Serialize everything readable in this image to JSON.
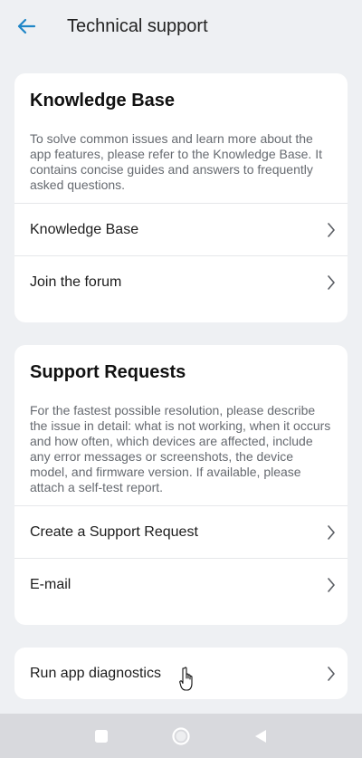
{
  "header": {
    "title": "Technical support",
    "back_icon": "arrow-left-icon",
    "accent_color": "#1f86c7"
  },
  "knowledge_card": {
    "title": "Knowledge Base",
    "description": "To solve common issues and learn more about the app features, please refer to the Knowledge Base. It contains concise guides and answers to frequently asked questions.",
    "items": [
      {
        "label": "Knowledge Base",
        "icon": "chevron-right-icon"
      },
      {
        "label": "Join the forum",
        "icon": "chevron-right-icon"
      }
    ]
  },
  "support_card": {
    "title": "Support Requests",
    "description": "For the fastest possible resolution, please describe the issue in detail: what is not working, when it occurs and how often, which devices are affected, include any error messages or screenshots, the device model, and firmware version. If available, please attach a self-test report.",
    "items": [
      {
        "label": "Create a Support Request",
        "icon": "chevron-right-icon"
      },
      {
        "label": "E-mail",
        "icon": "chevron-right-icon"
      }
    ]
  },
  "diagnostics_card": {
    "items": [
      {
        "label": "Run app diagnostics",
        "icon": "chevron-right-icon"
      }
    ]
  },
  "system_nav": {
    "icons": [
      "recents-square-icon",
      "home-circle-icon",
      "back-triangle-icon"
    ],
    "background": "#d8d9dd"
  }
}
